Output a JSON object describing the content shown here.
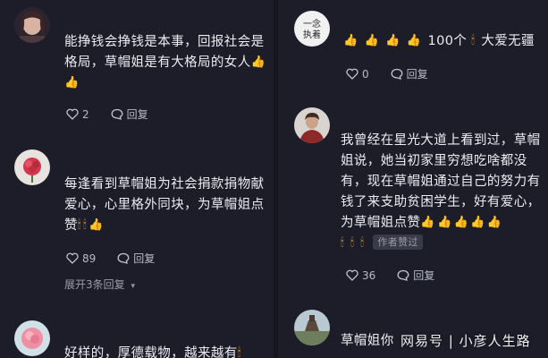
{
  "left": {
    "comments": [
      {
        "line1": "能挣钱会挣钱是本事，回报社会是",
        "line2": "格局，草帽姐是有大格局的女人",
        "line3": "",
        "likes": "2",
        "reply_label": "回复"
      },
      {
        "line1": "每逢看到草帽姐为社会捐款捐物献",
        "line2": "爱心，心里格外同块，为草帽姐点",
        "line3": "赞",
        "likes": "89",
        "reply_label": "回复",
        "expand_label": "展开3条回复"
      },
      {
        "line1": "好样的，厚德载物，越来越有",
        "line2": "",
        "line3": ""
      }
    ]
  },
  "right": {
    "comments": [
      {
        "line1_suffix": "100个",
        "line1_tail": "大爱无疆",
        "likes": "0",
        "reply_label": "回复"
      },
      {
        "line1": "我曾经在星光大道上看到过，草帽",
        "line2": "姐说，她当初家里穷想吃啥都没",
        "line3": "有，现在草帽姐通过自己的努力有",
        "line4": "钱了来支助贫困学生，好有爱心，",
        "line5": "为草帽姐点赞",
        "author_tag": "作者赞过",
        "likes": "36",
        "reply_label": "回复"
      },
      {
        "line1": "草帽姐你"
      }
    ]
  },
  "watermark": "网易号 | 小彦人生路",
  "icons": {
    "heart": "heart-icon",
    "reply": "reply-bubble-icon",
    "thumb": "thumbs-up-emoji-icon",
    "candle": "candle-emoji-icon",
    "expand": "chevron-down-icon"
  },
  "colors": {
    "background": "#1c1d29",
    "text": "#ececf2",
    "meta": "#b9bac4"
  }
}
